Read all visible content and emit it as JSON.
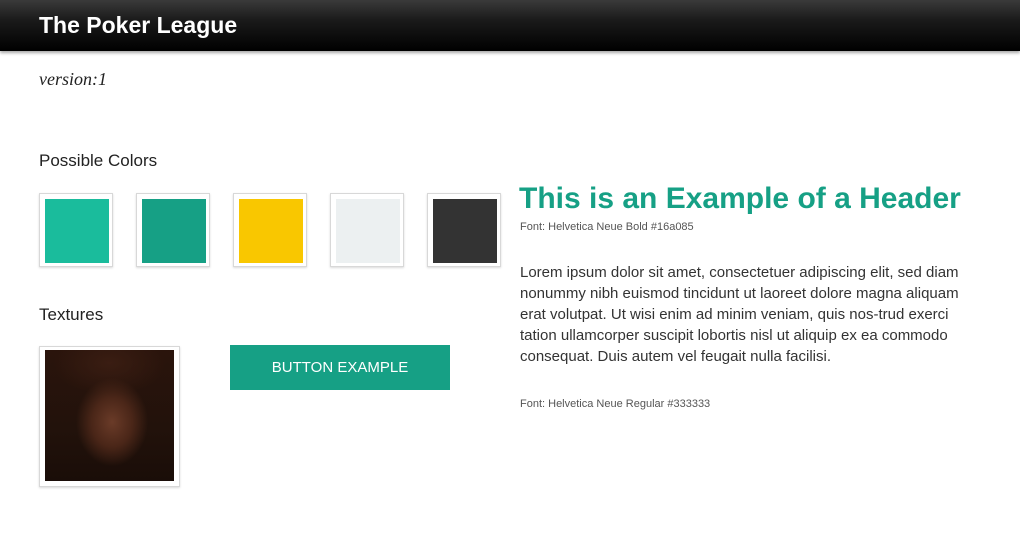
{
  "header": {
    "title": "The Poker League"
  },
  "version": "version:1",
  "colors": {
    "label": "Possible Colors",
    "swatches": [
      "#1abc9c",
      "#16a085",
      "#f9c700",
      "#ecf0f1",
      "#333333"
    ]
  },
  "textures": {
    "label": "Textures"
  },
  "button": {
    "label": "BUTTON EXAMPLE"
  },
  "typography": {
    "header_example": "This is an Example of a Header",
    "header_font_note": "Font: Helvetica Neue Bold #16a085",
    "body_example": "Lorem ipsum dolor sit amet, consectetuer adipiscing elit, sed diam nonummy nibh euismod tincidunt ut laoreet dolore magna aliquam erat volutpat. Ut wisi enim ad minim veniam, quis nos-trud exerci tation ullamcorper suscipit lobortis nisl ut aliquip ex ea commodo consequat. Duis autem vel feugait nulla facilisi.",
    "body_font_note": "Font: Helvetica Neue Regular #333333"
  }
}
